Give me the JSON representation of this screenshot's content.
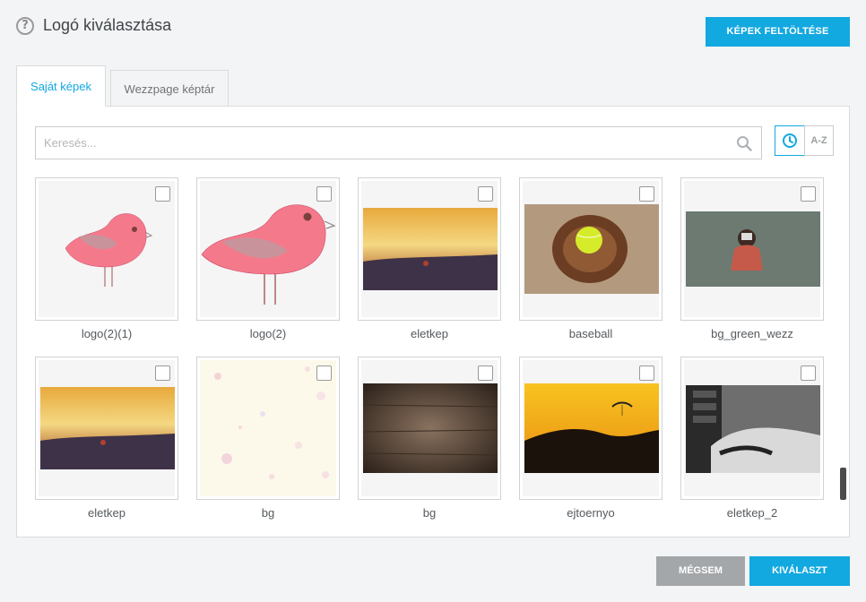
{
  "header": {
    "title": "Logó kiválasztása",
    "help_icon": "?",
    "upload_label": "KÉPEK FELTÖLTÉSE"
  },
  "tabs": [
    {
      "label": "Saját képek",
      "active": true
    },
    {
      "label": "Wezzpage képtár",
      "active": false
    }
  ],
  "search": {
    "placeholder": "Keresés...",
    "value": ""
  },
  "sort": {
    "time_icon": "clock-icon",
    "az_label": "A-Z",
    "active": "time"
  },
  "images": [
    {
      "label": "logo(2)(1)",
      "checked": false
    },
    {
      "label": "logo(2)",
      "checked": false
    },
    {
      "label": "eletkep",
      "checked": false
    },
    {
      "label": "baseball",
      "checked": false
    },
    {
      "label": "bg_green_wezz",
      "checked": false
    },
    {
      "label": "eletkep",
      "checked": false
    },
    {
      "label": "bg",
      "checked": false
    },
    {
      "label": "bg",
      "checked": false
    },
    {
      "label": "ejtoernyo",
      "checked": false
    },
    {
      "label": "eletkep_2",
      "checked": false
    }
  ],
  "footer": {
    "cancel_label": "MÉGSEM",
    "select_label": "KIVÁLASZT"
  },
  "colors": {
    "accent": "#12a8e0",
    "cancel": "#a4a7aa"
  }
}
